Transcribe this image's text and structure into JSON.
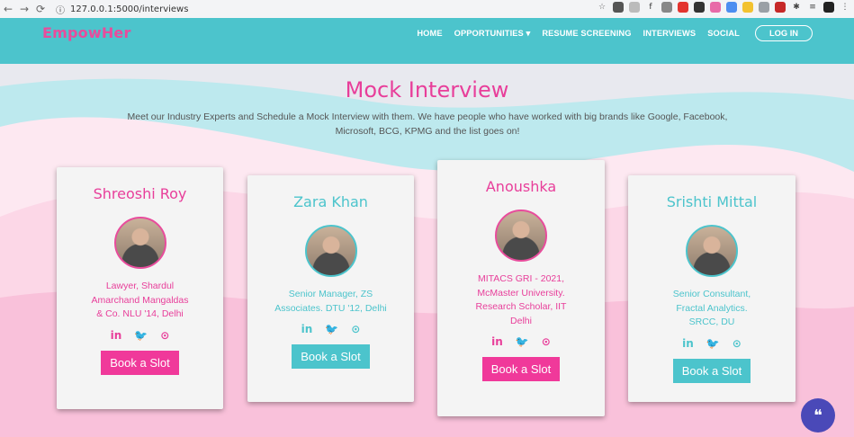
{
  "browser": {
    "url": "127.0.0.1:5000/interviews"
  },
  "navbar": {
    "brand": "EmpowHer",
    "items": [
      "HOME",
      "OPPORTUNITIES",
      "RESUME SCREENING",
      "INTERVIEWS",
      "SOCIAL"
    ],
    "login": "LOG IN"
  },
  "page": {
    "title": "Mock Interview",
    "subtitle": "Meet our Industry Experts and Schedule a Mock Interview with them. We have people who have worked with big brands like Google, Facebook, Microsoft, BCG, KPMG and the list goes on!"
  },
  "experts": [
    {
      "name": "Shreoshi Roy",
      "desc": "Lawyer, Shardul Amarchand Mangaldas & Co. NLU '14, Delhi",
      "button": "Book a Slot",
      "theme": "pink"
    },
    {
      "name": "Zara Khan",
      "desc": "Senior Manager, ZS Associates. DTU '12, Delhi",
      "button": "Book a Slot",
      "theme": "teal"
    },
    {
      "name": "Anoushka",
      "desc": "MITACS GRI - 2021, McMaster University. Research Scholar, IIT Delhi",
      "button": "Book a Slot",
      "theme": "pink"
    },
    {
      "name": "Srishti Mittal",
      "desc": "Senior Consultant, Fractal Analytics. SRCC, DU",
      "button": "Book a Slot",
      "theme": "teal"
    }
  ],
  "social_labels": {
    "linkedin": "in",
    "twitter": "🐦",
    "github": "⊙"
  }
}
